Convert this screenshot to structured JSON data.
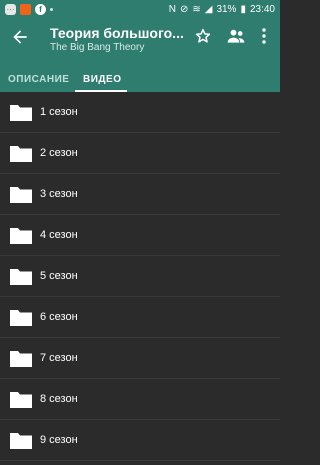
{
  "status_bar": {
    "battery": "31%",
    "time": "23:40"
  },
  "app_bar": {
    "title": "Теория большого...",
    "subtitle": "The Big Bang Theory"
  },
  "tabs": [
    {
      "label": "ОПИСАНИЕ",
      "active": false
    },
    {
      "label": "ВИДЕО",
      "active": true
    }
  ],
  "seasons": [
    {
      "label": "1 сезон"
    },
    {
      "label": "2 сезон"
    },
    {
      "label": "3 сезон"
    },
    {
      "label": "4 сезон"
    },
    {
      "label": "5 сезон"
    },
    {
      "label": "6 сезон"
    },
    {
      "label": "7 сезон"
    },
    {
      "label": "8 сезон"
    },
    {
      "label": "9 сезон"
    }
  ],
  "icons": {
    "back": "arrow-back-icon",
    "star": "star-outline-icon",
    "people": "people-icon",
    "menu": "more-vert-icon",
    "folder": "folder-icon"
  },
  "colors": {
    "accent": "#2e7d6f",
    "background": "#2b2b2b"
  }
}
